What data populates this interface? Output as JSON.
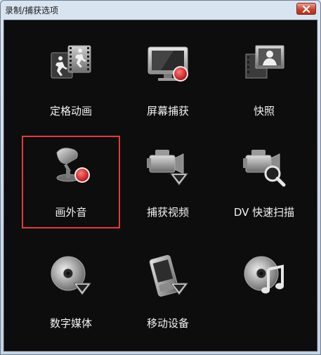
{
  "window": {
    "title": "录制/捕获选项"
  },
  "options": [
    {
      "label": "定格动画",
      "icon": "stop-motion-icon"
    },
    {
      "label": "屏幕捕获",
      "icon": "screen-capture-icon"
    },
    {
      "label": "快照",
      "icon": "snapshot-icon"
    },
    {
      "label": "画外音",
      "icon": "voiceover-microphone-icon",
      "selected": true
    },
    {
      "label": "捕获视频",
      "icon": "capture-video-icon"
    },
    {
      "label": "DV 快速扫描",
      "icon": "dv-quick-scan-icon"
    },
    {
      "label": "数字媒体",
      "icon": "digital-media-disc-icon"
    },
    {
      "label": "移动设备",
      "icon": "mobile-device-icon"
    },
    {
      "label": "",
      "icon": "audio-cd-music-icon"
    }
  ],
  "colors": {
    "selection_border": "#e13b3b",
    "record_dot": "#d21f1f",
    "background": "#0d0d0d"
  }
}
